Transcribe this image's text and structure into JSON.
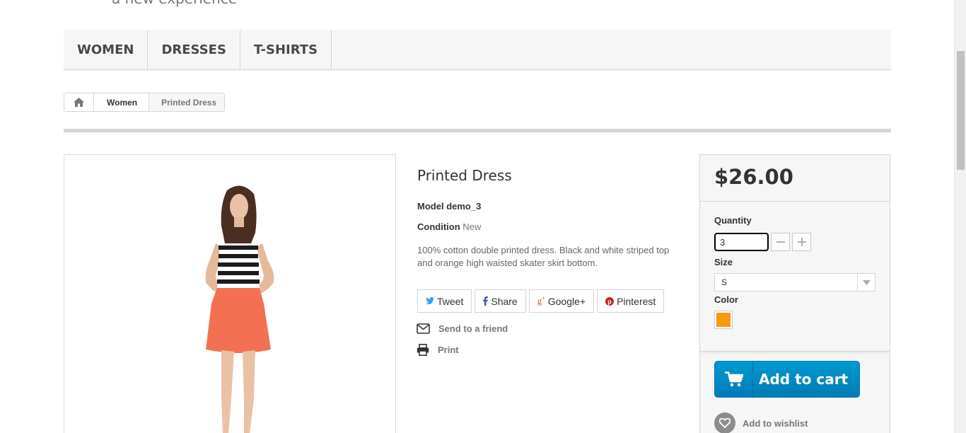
{
  "header": {
    "tagline": "a new experience"
  },
  "menu": [
    {
      "label": "WOMEN"
    },
    {
      "label": "DRESSES"
    },
    {
      "label": "T-SHIRTS"
    }
  ],
  "breadcrumb": {
    "home_icon": "home-icon",
    "parent": "Women",
    "current": "Printed Dress"
  },
  "product": {
    "name": "Printed Dress",
    "model_label": "Model",
    "model_value": "demo_3",
    "condition_label": "Condition",
    "condition_value": "New",
    "description": "100% cotton double printed dress. Black and white striped top and orange high waisted skater skirt bottom."
  },
  "social": [
    {
      "label": "Tweet",
      "icon": "twitter-icon"
    },
    {
      "label": "Share",
      "icon": "facebook-icon"
    },
    {
      "label": "Google+",
      "icon": "google-plus-icon"
    },
    {
      "label": "Pinterest",
      "icon": "pinterest-icon"
    }
  ],
  "actions": {
    "send_to_friend": "Send to a friend",
    "print": "Print"
  },
  "buy": {
    "price": "$26.00",
    "quantity_label": "Quantity",
    "quantity_value": "3",
    "size_label": "Size",
    "size_value": "S",
    "color_label": "Color",
    "color_swatch": "#f39c11",
    "add_to_cart": "Add to cart",
    "add_to_wishlist": "Add to wishlist"
  },
  "colors": {
    "accent": "#009ad0",
    "panel": "#f6f6f6",
    "skirt": "#f37052"
  }
}
